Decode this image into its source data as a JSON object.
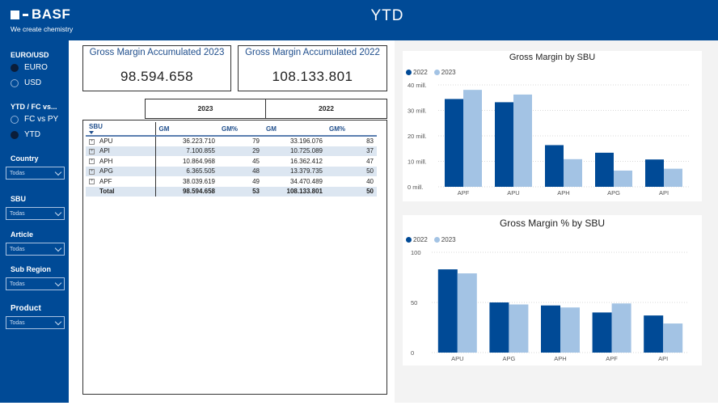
{
  "header": {
    "brand": "BASF",
    "tagline": "We create chemistry",
    "title": "YTD"
  },
  "sidebar": {
    "currency_title": "EURO/USD",
    "currency_options": [
      "EURO",
      "USD"
    ],
    "currency_selected": "EURO",
    "mode_title": "YTD / FC vs...",
    "mode_options": [
      "FC vs PY",
      "YTD"
    ],
    "mode_selected": "YTD",
    "filters": [
      {
        "label": "Country",
        "value": "Todas"
      },
      {
        "label": "SBU",
        "value": "Todas"
      },
      {
        "label": "Article",
        "value": "Todas"
      },
      {
        "label": "Sub Region",
        "value": "Todas"
      },
      {
        "label": "Product",
        "value": "Todas"
      }
    ]
  },
  "kpis": {
    "k2023": {
      "label": "Gross Margin Accumulated 2023",
      "value": "98.594.658"
    },
    "k2022": {
      "label": "Gross Margin Accumulated 2022",
      "value": "108.133.801"
    }
  },
  "matrix": {
    "year_headers": [
      "2023",
      "2022"
    ],
    "columns": [
      "SBU",
      "GM",
      "GM%",
      "GM",
      "GM%"
    ],
    "rows": [
      {
        "sbu": "APU",
        "gm23": "36.223.710",
        "pct23": "79",
        "gm22": "33.196.076",
        "pct22": "83"
      },
      {
        "sbu": "API",
        "gm23": "7.100.855",
        "pct23": "29",
        "gm22": "10.725.089",
        "pct22": "37"
      },
      {
        "sbu": "APH",
        "gm23": "10.864.968",
        "pct23": "45",
        "gm22": "16.362.412",
        "pct22": "47"
      },
      {
        "sbu": "APG",
        "gm23": "6.365.505",
        "pct23": "48",
        "gm22": "13.379.735",
        "pct22": "50"
      },
      {
        "sbu": "APF",
        "gm23": "38.039.619",
        "pct23": "49",
        "gm22": "34.470.489",
        "pct22": "40"
      }
    ],
    "total": {
      "sbu": "Total",
      "gm23": "98.594.658",
      "pct23": "53",
      "gm22": "108.133.801",
      "pct22": "50"
    }
  },
  "colors": {
    "y2022": "#004a96",
    "y2023": "#a3c3e4",
    "brand": "#004a96"
  },
  "chart_data": [
    {
      "type": "bar",
      "title": "Gross Margin by SBU",
      "categories": [
        "APF",
        "APU",
        "APH",
        "APG",
        "API"
      ],
      "series": [
        {
          "name": "2022",
          "values": [
            34.47,
            33.2,
            16.36,
            13.38,
            10.73
          ]
        },
        {
          "name": "2023",
          "values": [
            38.04,
            36.22,
            10.86,
            6.37,
            7.1
          ]
        }
      ],
      "yticks": [
        0,
        10,
        20,
        30,
        40
      ],
      "ytick_labels": [
        "0 mill.",
        "10 mill.",
        "20 mill.",
        "30 mill.",
        "40 mill."
      ],
      "ylim": [
        0,
        40
      ],
      "legend": "top-left"
    },
    {
      "type": "bar",
      "title": "Gross Margin % by SBU",
      "categories": [
        "APU",
        "APG",
        "APH",
        "APF",
        "API"
      ],
      "series": [
        {
          "name": "2022",
          "values": [
            83,
            50,
            47,
            40,
            37
          ]
        },
        {
          "name": "2023",
          "values": [
            79,
            48,
            45,
            49,
            29
          ]
        }
      ],
      "yticks": [
        0,
        50,
        100
      ],
      "ytick_labels": [
        "0",
        "50",
        "100"
      ],
      "ylim": [
        0,
        100
      ],
      "legend": "top-left"
    }
  ]
}
